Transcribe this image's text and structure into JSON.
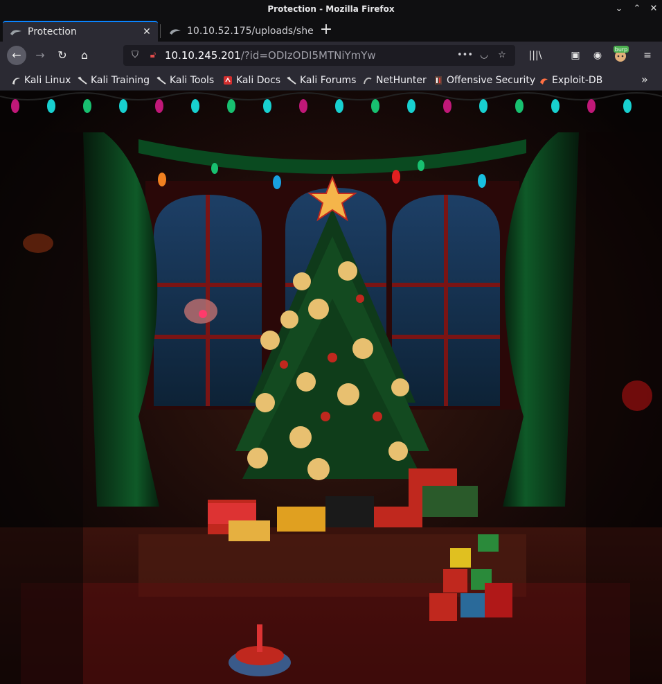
{
  "window": {
    "title": "Protection - Mozilla Firefox"
  },
  "tabs": [
    {
      "label": "Protection",
      "active": true
    },
    {
      "label": "10.10.52.175/uploads/she",
      "active": false
    }
  ],
  "toolbar": {
    "url_host": "10.10.245.201",
    "url_path": "/?id=ODIzODI5MTNiYmYw",
    "burp_badge": "burp"
  },
  "bookmarks": [
    {
      "label": "Kali Linux",
      "icon": "kali-dragon-icon"
    },
    {
      "label": "Kali Training",
      "icon": "kali-dragon-icon"
    },
    {
      "label": "Kali Tools",
      "icon": "kali-dragon-icon"
    },
    {
      "label": "Kali Docs",
      "icon": "kali-docs-icon"
    },
    {
      "label": "Kali Forums",
      "icon": "kali-dragon-icon"
    },
    {
      "label": "NetHunter",
      "icon": "nethunter-icon"
    },
    {
      "label": "Offensive Security",
      "icon": "offsec-icon"
    },
    {
      "label": "Exploit-DB",
      "icon": "exploitdb-icon"
    }
  ],
  "colors": {
    "accent": "#0a84ff",
    "chrome_bg": "#2b2a33",
    "titlebar_bg": "#0f0f11"
  }
}
